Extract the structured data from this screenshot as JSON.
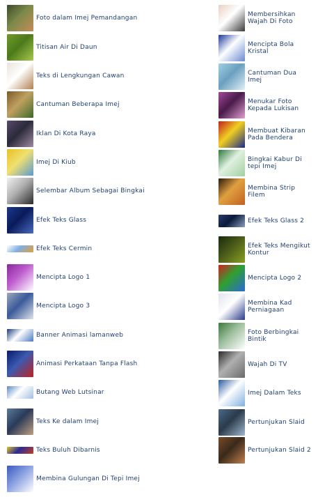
{
  "left_items": [
    {
      "label": "Foto dalam Imej Pemandangan",
      "icon": "portrait-photo-icon",
      "colors": [
        "#3b4a2a",
        "#c58c5a",
        "#7c8a4a"
      ]
    },
    {
      "label": "Titisan Air Di Daun",
      "icon": "leaf-water-drop-icon",
      "colors": [
        "#6f9a2a",
        "#a8c850",
        "#4c7a1a"
      ]
    },
    {
      "label": "Teks di Lengkungan Cawan",
      "icon": "coffee-cup-icon",
      "colors": [
        "#e8e4dc",
        "#b08050",
        "#ffffff"
      ]
    },
    {
      "label": "Cantuman Beberapa Imej",
      "icon": "collage-photo-icon",
      "colors": [
        "#7a5a2a",
        "#3a6a2a",
        "#c0a060"
      ]
    },
    {
      "label": "Iklan Di Kota Raya",
      "icon": "city-building-icon",
      "colors": [
        "#5a4a6a",
        "#a08aa0",
        "#2a2a3a"
      ]
    },
    {
      "label": "Imej Di Kiub",
      "icon": "cube-photo-icon",
      "colors": [
        "#e8c020",
        "#5a9ad0",
        "#f0e070"
      ]
    },
    {
      "label": "Selembar Album Sebagai Bingkai",
      "icon": "album-frame-icon",
      "colors": [
        "#f0f0f0",
        "#2a2a2a",
        "#b0b0b0"
      ]
    },
    {
      "label": "Efek Teks Glass",
      "icon": "glass-text-icon",
      "colors": [
        "#1a3a8a",
        "#4a6ac0",
        "#0a1a5a"
      ]
    },
    {
      "label": "Efek Teks Cermin",
      "icon": "mirror-text-icon",
      "colors": [
        "#ffffff",
        "#e0a040",
        "#80b0e0"
      ]
    },
    {
      "label": "Mencipta Logo 1",
      "icon": "purple-logo-icon",
      "colors": [
        "#8a2a9a",
        "#ffffff",
        "#c060d0"
      ]
    },
    {
      "label": "Mencipta Logo 3",
      "icon": "robot-logo-icon",
      "colors": [
        "#a0a8b8",
        "#e0e4ea",
        "#3a5a9a"
      ]
    },
    {
      "label": "Banner Animasi lamanweb",
      "icon": "banner-icon",
      "colors": [
        "#1a3a7a",
        "#4a7ac0",
        "#ffffff"
      ]
    },
    {
      "label": "Animasi Perkataan Tanpa Flash",
      "icon": "animation-text-icon",
      "colors": [
        "#0a1a6a",
        "#c02020",
        "#3a5ab0"
      ]
    },
    {
      "label": "Butang Web Lutsinar",
      "icon": "web-button-icon",
      "colors": [
        "#5a8ac0",
        "#a0c0e0",
        "#ffffff"
      ]
    },
    {
      "label": "Teks Ke dalam Imej",
      "icon": "text-in-image-icon",
      "colors": [
        "#5a7a9a",
        "#c0a080",
        "#2a3a5a"
      ]
    },
    {
      "label": "Teks Buluh Dibarnis",
      "icon": "bamboo-text-icon",
      "colors": [
        "#e0c020",
        "#c04020",
        "#2a2a9a"
      ]
    },
    {
      "label": "Membina Gulungan Di Tepi Imej",
      "icon": "page-curl-icon",
      "colors": [
        "#3a5ac0",
        "#ffffff",
        "#8aa0e0"
      ]
    }
  ],
  "right_items": [
    {
      "label": "Membersihkan Wajah Di Foto",
      "icon": "face-photo-icon",
      "colors": [
        "#e8d0c0",
        "#3a3a3a",
        "#ffffff"
      ]
    },
    {
      "label": "Mencipta Bola Kristal",
      "icon": "crystal-ball-icon",
      "colors": [
        "#1a3a9a",
        "#6a8ad0",
        "#ffffff"
      ]
    },
    {
      "label": "Cantuman Dua Imej",
      "icon": "blend-images-icon",
      "colors": [
        "#a0d0e0",
        "#e0f0f8",
        "#6aa0c0"
      ]
    },
    {
      "label": "Menukar Foto Kepada Lukisan",
      "icon": "photo-painting-icon",
      "colors": [
        "#a04a9a",
        "#e0a0d0",
        "#4a1a4a"
      ]
    },
    {
      "label": "Membuat Kibaran Pada Bendera",
      "icon": "waving-flag-icon",
      "colors": [
        "#c02020",
        "#1a2a8a",
        "#f0d020"
      ]
    },
    {
      "label": "Bingkai Kabur Di tepi Imej",
      "icon": "blur-frame-icon",
      "colors": [
        "#2a7a3a",
        "#a0d0a0",
        "#e0f0e0"
      ]
    },
    {
      "label": "Membina Strip Filem",
      "icon": "film-strip-icon",
      "colors": [
        "#2a1a0a",
        "#c06020",
        "#e0a040"
      ]
    },
    {
      "label": "Efek Teks Glass 2",
      "icon": "glass-text-2-icon",
      "colors": [
        "#2a3a6a",
        "#8aa0c0",
        "#0a1a3a"
      ]
    },
    {
      "label": "Efek Teks Mengikut Kontur",
      "icon": "contour-text-icon",
      "colors": [
        "#1a2a0a",
        "#8aa020",
        "#4a5a1a"
      ]
    },
    {
      "label": "Mencipta Logo 2",
      "icon": "diamond-logo-icon",
      "colors": [
        "#d02020",
        "#2a6ad0",
        "#30a030"
      ]
    },
    {
      "label": "Membina Kad Perniagaan",
      "icon": "business-card-icon",
      "colors": [
        "#e0e4f0",
        "#2a3a8a",
        "#ffffff"
      ]
    },
    {
      "label": "Foto Berbingkai Bintik",
      "icon": "dotted-frame-icon",
      "colors": [
        "#3a7a3a",
        "#ffffff",
        "#a0c0a0"
      ]
    },
    {
      "label": "Wajah Di TV",
      "icon": "tv-icon",
      "colors": [
        "#2a2a2a",
        "#6a6a6a",
        "#b0b0b0"
      ]
    },
    {
      "label": "Imej Dalam Teks",
      "icon": "image-in-text-icon",
      "colors": [
        "#2a5aa0",
        "#80b0e0",
        "#ffffff"
      ]
    },
    {
      "label": "Pertunjukan Slaid",
      "icon": "slideshow-icon",
      "colors": [
        "#4a6a8a",
        "#a0b8d0",
        "#2a3a4a"
      ]
    },
    {
      "label": "Pertunjukan Slaid 2",
      "icon": "slideshow-2-icon",
      "colors": [
        "#7a4a2a",
        "#c08050",
        "#3a2a1a"
      ]
    }
  ]
}
